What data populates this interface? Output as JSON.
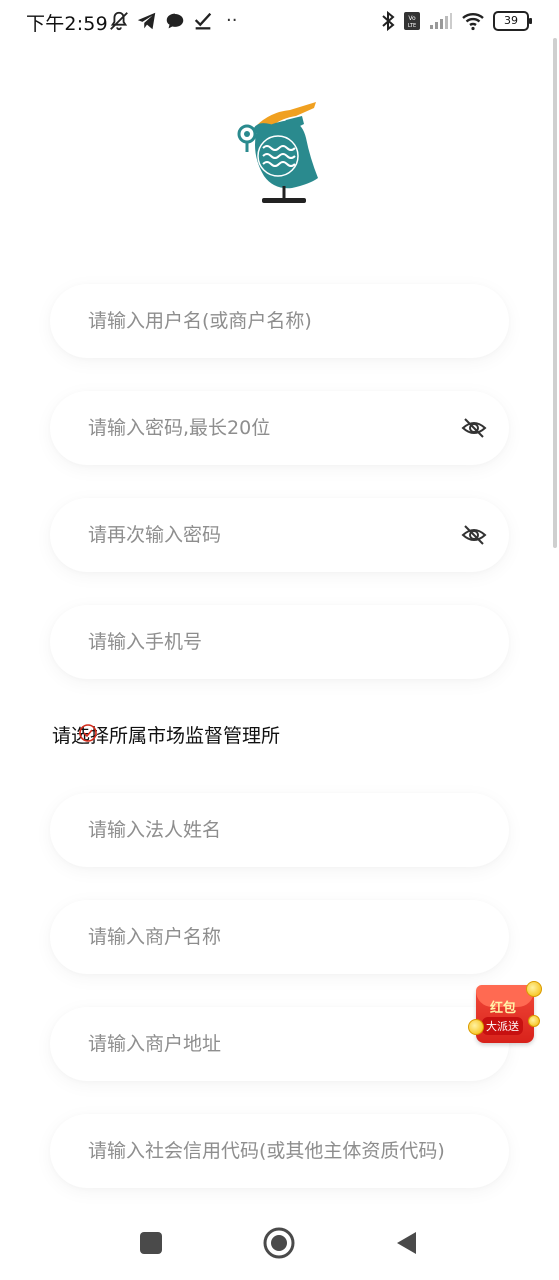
{
  "status_bar": {
    "time": "下午2:59",
    "battery": "39",
    "dots": "··",
    "icons": [
      "mute-icon",
      "telegram-icon",
      "chat-icon",
      "check-icon",
      "bluetooth-icon",
      "volte-icon",
      "signal-icon",
      "wifi-icon",
      "battery-icon"
    ]
  },
  "form": {
    "username_placeholder": "请输入用户名(或商户名称)",
    "password_placeholder": "请输入密码,最长20位",
    "confirm_password_placeholder": "请再次输入密码",
    "phone_placeholder": "请输入手机号",
    "market_select_label": "请选择所属市场监督管理所",
    "legal_person_placeholder": "请输入法人姓名",
    "merchant_name_placeholder": "请输入商户名称",
    "merchant_address_placeholder": "请输入商户地址",
    "credit_code_placeholder": "请输入社会信用代码(或其他主体资质代码)"
  },
  "red_envelope": {
    "line1": "红包",
    "line2": "大派送"
  },
  "colors": {
    "logo_teal": "#2a8a8e",
    "logo_orange": "#f0a020",
    "placeholder": "#8e8e8e",
    "envelope_red": "#e0301f"
  }
}
